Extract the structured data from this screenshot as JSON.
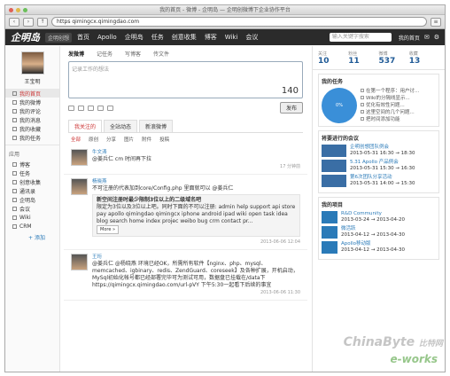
{
  "window": {
    "title": "我的首页 - 微博 - 企明岛 — 企明创微博下企业协作平台"
  },
  "address": {
    "url": "qimingcx.qimingdao.com",
    "proto": "https"
  },
  "nav": {
    "logo": "企明岛",
    "project": "企明创想",
    "links": [
      "首页",
      "Apollo",
      "企明岛",
      "任务",
      "创意收集",
      "博客",
      "Wiki",
      "会议"
    ],
    "search_placeholder": "输入关键字搜索",
    "user": "我的首页"
  },
  "sidebar": {
    "user_name": "王宝明",
    "items": [
      {
        "label": "我的首页",
        "active": true
      },
      {
        "label": "我的微博"
      },
      {
        "label": "我的评论"
      },
      {
        "label": "我的消息"
      },
      {
        "label": "我的收藏"
      },
      {
        "label": "我的任务"
      }
    ],
    "apps_title": "应用",
    "apps": [
      "博客",
      "任务",
      "创意收集",
      "通讯录",
      "企明岛",
      "会议",
      "Wiki",
      "CRM"
    ],
    "add_label": "添加"
  },
  "publisher": {
    "tabs": [
      "发微博",
      "记任务",
      "写博客",
      "传文件"
    ],
    "placeholder": "记录工作的想法",
    "count": "140",
    "publish_label": "发布"
  },
  "feed": {
    "tabs": [
      "我关注的",
      "全站动态",
      "新浪微博"
    ],
    "filters": [
      "全部",
      "原创",
      "分享",
      "图片",
      "附件",
      "投稿"
    ],
    "posts": [
      {
        "author": "牛文涛",
        "text": "@姜兵仁 cm 时间再下拉",
        "time": "17 分钟前"
      },
      {
        "author": "杨晓燕",
        "text": "不可注册的代表加到core/Config.php 里面就可以 @姜兵仁",
        "quote_title": "新空间注册时最少限制3位以上的二级域名吧",
        "quote_body": "限定为3位以及3位以上吧。同时下面的不可以注册: admin help support api store pay apollo qimingdao qimingcx iphone android ipad wiki open task idea blog search home index projec weibo bug crm contact pr...",
        "more": "More »",
        "time": "2013-06-06 12:04"
      },
      {
        "author": "王珩",
        "text": "@姜兵仁 @杨晓燕 环境已经OK，所需所有软件【nginx、php、mysql、memcached、igbinary、redis、ZendGuard、coreseek】及各种扩展，开机启动，MySql初始化帐号都已经部署完毕可为测试可用，数据盘已挂载在/data下https://qimingcx.qimingdao.com/url-pVY 下午5:30一起看下后续的事宜",
        "time": "2013-06-06 11:30"
      }
    ]
  },
  "stats": [
    {
      "label": "关注",
      "value": "10"
    },
    {
      "label": "粉丝",
      "value": "11"
    },
    {
      "label": "微博",
      "value": "537"
    },
    {
      "label": "收藏",
      "value": "13"
    }
  ],
  "tasks": {
    "title": "我的任务",
    "pie_label": "0%",
    "items": [
      "在第一个程序：用户讨...",
      "Wiki的分隔线显示...",
      "优化有效性问题...",
      "这里空间的几个问题...",
      "把时间添加功能"
    ]
  },
  "meetings": {
    "title": "将要进行的会议",
    "items": [
      {
        "name": "企明创想团队例会",
        "time": "2013-05-31 16:30 → 18:30"
      },
      {
        "name": "5.31 Apollo 产品例会",
        "time": "2013-05-31 15:30 → 16:30"
      },
      {
        "name": "第6次团队分享活动",
        "time": "2013-05-31 14:00 → 15:30"
      }
    ]
  },
  "projects": {
    "title": "我的项目",
    "items": [
      {
        "name": "R&D Community",
        "time": "2013-03-24 → 2013-04-20"
      },
      {
        "name": "微活跃",
        "time": "2013-04-12 → 2013-04-30"
      },
      {
        "name": "Apollo移动版",
        "time": "2013-04-12 → 2013-04-30"
      }
    ]
  },
  "watermark": {
    "brand1": "ChinaByte",
    "brand2": "比特网",
    "brand3": "e-works"
  }
}
